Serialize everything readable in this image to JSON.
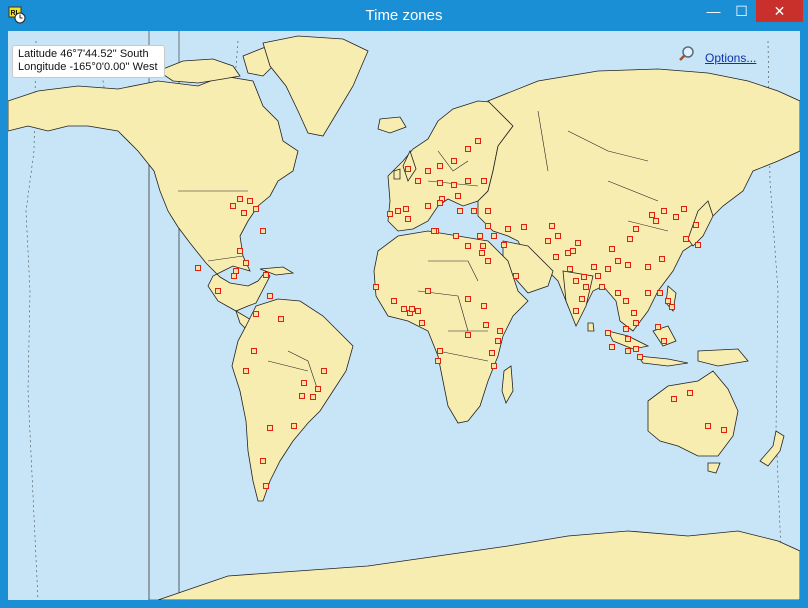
{
  "window": {
    "title": "Time zones",
    "minimize": "—",
    "maximize": "☐",
    "close": "✕"
  },
  "coords": {
    "latitude": "Latitude 46°7'44.52'' South",
    "longitude": "Longitude -165°0'0.00'' West"
  },
  "options": {
    "label": "Options..."
  },
  "colors": {
    "ocean": "#c8e5f7",
    "land": "#f8edb0",
    "border": "#222222",
    "marker_fill": "#f7e3a1",
    "marker_stroke": "#e02010",
    "title_bar": "#1b8fd6"
  },
  "icons": [
    "app-icon",
    "magnifier-icon",
    "minimize-icon",
    "maximize-icon",
    "close-icon"
  ]
}
